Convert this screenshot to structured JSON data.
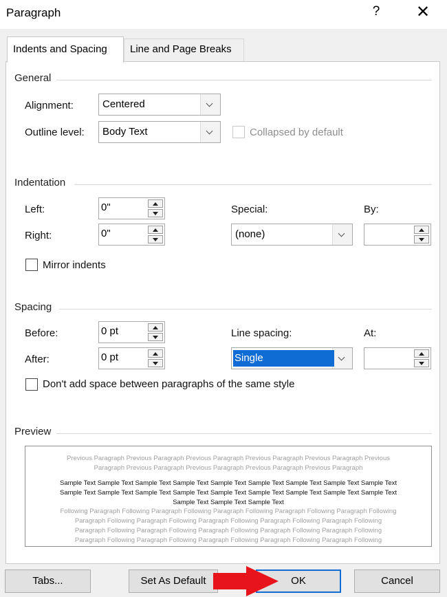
{
  "window": {
    "title": "Paragraph",
    "help": "?",
    "close": "✕"
  },
  "tabs": [
    {
      "label": "Indents and Spacing",
      "active": true
    },
    {
      "label": "Line and Page Breaks",
      "active": false
    }
  ],
  "general": {
    "heading": "General",
    "alignment_label": "Alignment:",
    "alignment_value": "Centered",
    "outline_label": "Outline level:",
    "outline_value": "Body Text",
    "collapsed_label": "Collapsed by default"
  },
  "indentation": {
    "heading": "Indentation",
    "left_label": "Left:",
    "left_value": "0\"",
    "right_label": "Right:",
    "right_value": "0\"",
    "special_label": "Special:",
    "special_value": "(none)",
    "by_label": "By:",
    "by_value": "",
    "mirror_label": "Mirror indents"
  },
  "spacing": {
    "heading": "Spacing",
    "before_label": "Before:",
    "before_value": "0 pt",
    "after_label": "After:",
    "after_value": "0 pt",
    "line_spacing_label": "Line spacing:",
    "line_spacing_value": "Single",
    "at_label": "At:",
    "at_value": "",
    "dont_add_label": "Don't add space between paragraphs of the same style"
  },
  "preview": {
    "heading": "Preview",
    "previous_lines": [
      "Previous Paragraph Previous Paragraph Previous Paragraph Previous Paragraph Previous Paragraph Previous",
      "Paragraph Previous Paragraph Previous Paragraph Previous Paragraph Previous Paragraph"
    ],
    "sample_lines": [
      "Sample Text Sample Text Sample Text Sample Text Sample Text Sample Text Sample Text Sample Text Sample Text",
      "Sample Text Sample Text Sample Text Sample Text Sample Text Sample Text Sample Text Sample Text Sample Text",
      "Sample Text Sample Text Sample Text"
    ],
    "following_lines": [
      "Following Paragraph Following Paragraph Following Paragraph Following Paragraph Following Paragraph Following",
      "Paragraph Following Paragraph Following Paragraph Following Paragraph Following Paragraph Following",
      "Paragraph Following Paragraph Following Paragraph Following Paragraph Following Paragraph Following",
      "Paragraph Following Paragraph Following Paragraph Following Paragraph Following Paragraph Following"
    ]
  },
  "buttons": {
    "tabs": "Tabs...",
    "set_default": "Set As Default",
    "ok": "OK",
    "cancel": "Cancel"
  },
  "colors": {
    "accent": "#0f6cd4",
    "arrow": "#e8141c",
    "dialog_bg": "#f0f0f0"
  },
  "icons": {
    "close": "close-icon",
    "help": "help-icon",
    "dropdown": "chevron-down-icon",
    "spin_up": "spin-up-icon",
    "spin_down": "spin-down-icon",
    "arrow": "red-arrow-icon"
  }
}
